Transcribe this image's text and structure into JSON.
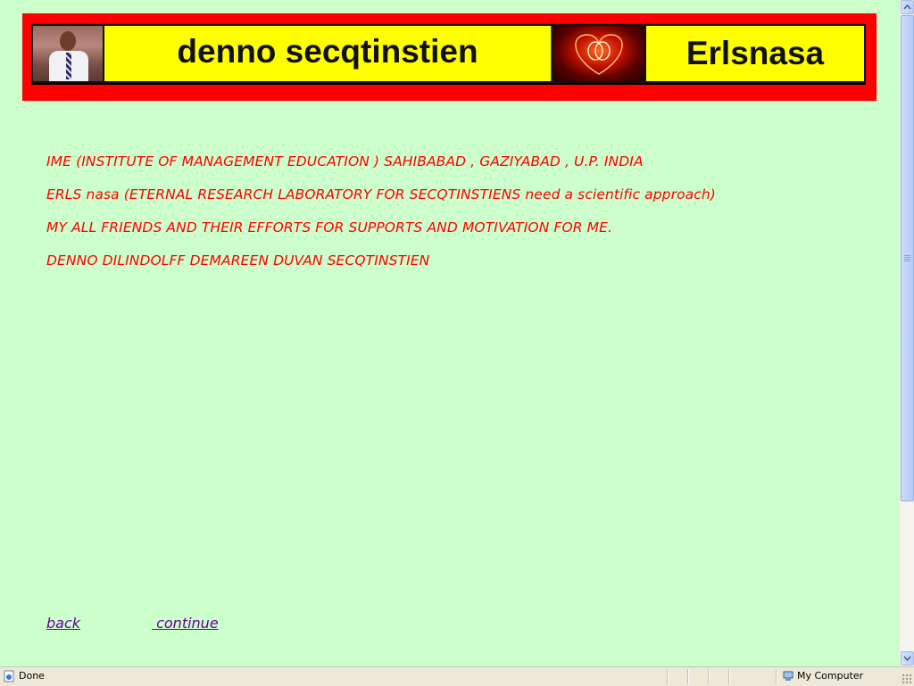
{
  "banner": {
    "title": "denno secqtinstien",
    "brand": "Erlsnasa",
    "colors": {
      "frame": "#ff0000",
      "panel": "#ffff00"
    }
  },
  "acknowledgements": [
    "IME (INSTITUTE OF MANAGEMENT EDUCATION ) SAHIBABAD , GAZIYABAD , U.P. INDIA",
    "ERLS nasa (ETERNAL RESEARCH LABORATORY FOR SECQTINSTIENS need a scientific approach)",
    "MY ALL FRIENDS AND THEIR EFFORTS FOR SUPPORTS AND MOTIVATION FOR ME.",
    "DENNO DILINDOLFF DEMAREEN DUVAN SECQTINSTIEN"
  ],
  "nav": {
    "back": "back",
    "continue": " continue"
  },
  "statusbar": {
    "status": "Done",
    "zone": "My Computer",
    "status_icon": "ie-page-icon",
    "zone_icon": "my-computer-icon"
  },
  "theme": {
    "page_background": "#ccffcc",
    "text_color": "#ff0000",
    "link_color": "#660099"
  }
}
